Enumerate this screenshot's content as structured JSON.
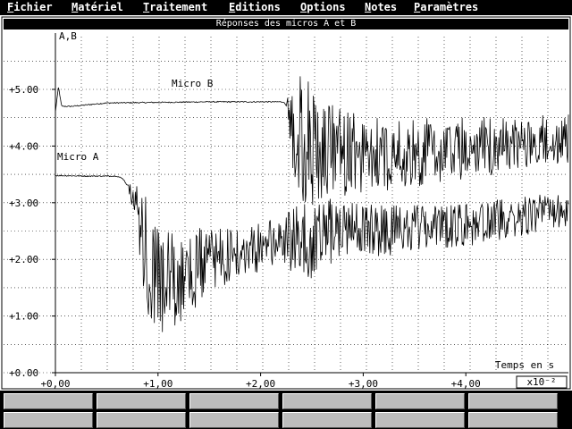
{
  "menu": [
    {
      "accel": "F",
      "rest": "ichier"
    },
    {
      "accel": "M",
      "rest": "até riel"
    },
    {
      "accel": "T",
      "rest": "raitement"
    },
    {
      "accel": "E",
      "rest": "ditions"
    },
    {
      "accel": "O",
      "rest": "ptions"
    },
    {
      "accel": "N",
      "rest": "otes"
    },
    {
      "accel": "P",
      "rest": "aramètres"
    }
  ],
  "chart_data": {
    "type": "line",
    "title": "Réponses des micros A et B",
    "ylabel": "A,B",
    "xlabel": "Temps en s",
    "x_multiplier": "x10⁻²",
    "xlim": [
      0,
      5.0
    ],
    "ylim": [
      0,
      5.9
    ],
    "grid": true,
    "x_ticks": [
      "+0,00",
      "+1,00",
      "+2,00",
      "+3,00",
      "+4,00"
    ],
    "y_ticks": [
      "+0.00",
      "+1.00",
      "+2.00",
      "+3.00",
      "+4.00",
      "+5.00"
    ],
    "series": [
      {
        "name": "Micro B",
        "points": [
          [
            0.0,
            4.6
          ],
          [
            0.03,
            5.05
          ],
          [
            0.06,
            4.7
          ],
          [
            0.15,
            4.7
          ],
          [
            0.5,
            4.76
          ],
          [
            1.0,
            4.77
          ],
          [
            1.5,
            4.78
          ],
          [
            2.0,
            4.78
          ],
          [
            2.22,
            4.78
          ],
          [
            2.26,
            4.7
          ],
          [
            2.32,
            4.3
          ],
          [
            2.5,
            3.95
          ],
          [
            3.0,
            3.85
          ],
          [
            3.5,
            3.9
          ],
          [
            4.0,
            3.95
          ],
          [
            4.5,
            4.05
          ],
          [
            5.0,
            4.15
          ]
        ],
        "oscillation": [
          [
            2.25,
            0.0
          ],
          [
            2.35,
            1.3
          ],
          [
            2.6,
            1.0
          ],
          [
            3.0,
            0.7
          ],
          [
            4.0,
            0.55
          ],
          [
            5.0,
            0.45
          ]
        ]
      },
      {
        "name": "Micro A",
        "points": [
          [
            0.0,
            3.48
          ],
          [
            0.3,
            3.47
          ],
          [
            0.6,
            3.47
          ],
          [
            0.66,
            3.42
          ],
          [
            0.72,
            3.25
          ],
          [
            0.8,
            2.8
          ],
          [
            0.9,
            1.8
          ],
          [
            1.0,
            1.55
          ],
          [
            1.2,
            1.7
          ],
          [
            1.5,
            1.95
          ],
          [
            2.0,
            2.25
          ],
          [
            2.5,
            2.42
          ],
          [
            3.0,
            2.5
          ],
          [
            3.5,
            2.55
          ],
          [
            4.0,
            2.62
          ],
          [
            4.5,
            2.72
          ],
          [
            5.0,
            2.85
          ]
        ],
        "oscillation": [
          [
            0.7,
            0.0
          ],
          [
            0.78,
            0.4
          ],
          [
            0.9,
            1.3
          ],
          [
            1.0,
            1.1
          ],
          [
            1.3,
            0.75
          ],
          [
            1.8,
            0.45
          ],
          [
            2.25,
            0.5
          ],
          [
            2.4,
            0.8
          ],
          [
            3.0,
            0.5
          ],
          [
            4.0,
            0.4
          ],
          [
            5.0,
            0.35
          ]
        ]
      }
    ]
  },
  "fkeys": [
    "",
    "",
    "",
    "",
    "",
    "",
    "",
    "",
    "",
    "",
    "",
    ""
  ]
}
